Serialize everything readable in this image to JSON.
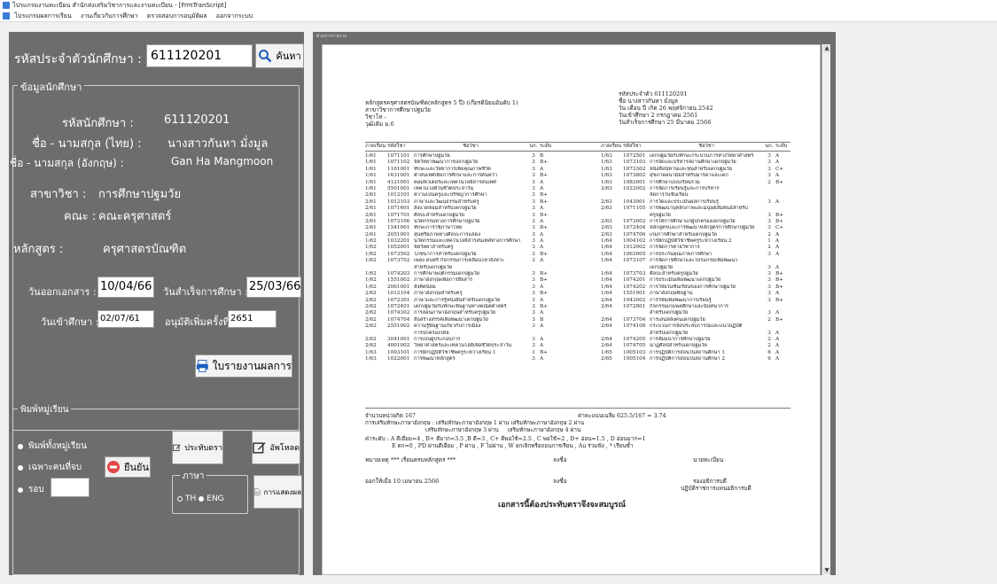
{
  "window": {
    "title": "โปรแกรมงานทะเบียน สำนักส่งเสริมวิชาการและงานทะเบียน - [FrmTranScript]"
  },
  "menu": [
    "โปรแกรมผลการเรียน",
    "งานเกี่ยวกับการศึกษา",
    "ตรวจสอบการอนุมัติผล",
    "ออกจากระบบ"
  ],
  "left": {
    "student_id_label": "รหัสประจำตัวนักศึกษา :",
    "student_id_value": "611120201",
    "search_button": "ค้นหา",
    "info_group_title": "ข้อมูลนักศึกษา",
    "sid_label": "รหัสนักศึกษา :",
    "sid_value": "611120201",
    "name_th_label": "ชื่อ - นามสกุล (ไทย) :",
    "name_th_value": "นางสาวกันหา  มั่งมูล",
    "name_en_label": "ชื่อ - นามสกุล (อังกฤษ) :",
    "name_en_value": "Gan Ha  Mangmoon",
    "major_label": "สาขาวิชา :",
    "major_value": "การศึกษาปฐมวัย",
    "faculty_label": "คณะ :",
    "faculty_value": "คณะครุศาสตร์",
    "curriculum_label": "หลักสูตร :",
    "curriculum_value": "ครุศาสตรบัณฑิต",
    "issue_label": "วันออกเอกสาร :",
    "issue_value": "10/04/66",
    "grad_label": "วันสำเร็จการศึกษา :",
    "grad_value": "25/03/66",
    "enter_label": "วันเข้าศึกษา :",
    "enter_value": "02/07/61",
    "approve_label": "อนุมัติเพิ่มครั้งที่ :",
    "approve_value": "2651",
    "report_button": "ใบรายงานผลการ",
    "print_group_title": "พิมพ์หมู่เรียน",
    "radio_all": "พิมพ์ทั้งหมู่เรียน",
    "radio_only": "เฉพาะคนที่จบ",
    "radio_round": "รอบ",
    "confirm_button": "ยืนยัน",
    "cert_button": "ประทับตรา",
    "download_button": "อัพโหลด",
    "lang_group_title": "ภาษา",
    "lang_th": "TH",
    "lang_en": "ENG",
    "result_button": "การแสดงผล"
  },
  "report_frame_title": "ตัวอย่างรายงาน",
  "report": {
    "head_left": [
      "หลักสูตรครุศาสตรบัณฑิต(หลักสูตร 5 ปี) (เกียรตินิยมอันดับ 1)",
      "สาขาวิชาการศึกษาปฐมวัย",
      "วิชาโท -",
      "วุฒิเดิม ม.6"
    ],
    "head_right": [
      "รหัสประจำตัว 611120201",
      "ชื่อ นางสาวกันหา  มั่งมูล",
      "วัน เดือน ปี เกิด 26 พฤศจิกายน 2542",
      "วันเข้าศึกษา 2 กรกฎาคม 2561",
      "วันสำเร็จการศึกษา 25 มีนาคม 2566"
    ],
    "col_headers": [
      "ภาคเรียน",
      "รหัสวิชา",
      "ชื่อวิชา",
      "นก.",
      "ระดับ"
    ],
    "left_rows": [
      [
        "1/61",
        "1071101",
        "การศึกษาปฐมวัย",
        "3",
        "B"
      ],
      [
        "1/61",
        "1071102",
        "จิตวิทยาพัฒนาการเด็กปฐมวัย",
        "3",
        "B+"
      ],
      [
        "1/61",
        "1161001",
        "ทักษะและวิทยาการเพื่อคุณภาพชีวิต",
        "3",
        "A"
      ],
      [
        "1/61",
        "1631001",
        "ศาสนเทศเพื่อการศึกษาและการค้นคว้า",
        "3",
        "B+"
      ],
      [
        "1/61",
        "4121001",
        "คอมพิวเตอร์และเทคโนโลยีสารสนเทศ",
        "3",
        "A"
      ],
      [
        "1/61",
        "5501001",
        "เทคโนโลยีในชีวิตประจำวัน",
        "3",
        "A"
      ],
      [
        "2/61",
        "1012101",
        "ความเป็นครูและปรัชญาการศึกษา",
        "3",
        "B+"
      ],
      [
        "2/61",
        "1012103",
        "ภาษาและวัฒนธรรมสำหรับครู",
        "3",
        "B+"
      ],
      [
        "2/61",
        "1071601",
        "สิ่งแวดล้อมสำหรับเด็กปฐมวัย",
        "3",
        "A"
      ],
      [
        "2/61",
        "1071701",
        "ศิลปะสำหรับเด็กปฐมวัย",
        "3",
        "B+"
      ],
      [
        "2/61",
        "1072106",
        "นวัตกรรมทางการศึกษาปฐมวัย",
        "3",
        "A"
      ],
      [
        "2/61",
        "1541001",
        "ทักษะการใช้ภาษาไทย",
        "3",
        "B+"
      ],
      [
        "2/61",
        "2051001",
        "สุนทรียภาพทางศิลปะการแสดง",
        "3",
        "A"
      ],
      [
        "1/62",
        "1032201",
        "นวัตกรรมและเทคโนโลยีสารสนเทศทางการศึกษา",
        "3",
        "A"
      ],
      [
        "1/62",
        "1052001",
        "จิตวิทยาสำหรับครู",
        "3",
        "A"
      ],
      [
        "1/62",
        "1073502",
        "โภชนาการสำหรับเด็กปฐมวัย",
        "3",
        "B+"
      ],
      [
        "1/62",
        "1073702",
        "เพลง ดนตรี กิจกรรมการเคลื่อนไหวจังหวะ",
        "3",
        "A"
      ],
      [
        "",
        "",
        "สำหรับเด็กปฐมวัย",
        "",
        ""
      ],
      [
        "1/62",
        "1074203",
        "การศึกษาพฤติกรรมเด็กปฐมวัย",
        "3",
        "B+"
      ],
      [
        "1/62",
        "1551002",
        "ภาษาอังกฤษเพื่อการสื่อสาร",
        "3",
        "B+"
      ],
      [
        "1/62",
        "2061001",
        "สังคีตนิยม",
        "3",
        "A"
      ],
      [
        "2/62",
        "1012104",
        "ภาษาอังกฤษสำหรับครู",
        "3",
        "B+"
      ],
      [
        "2/62",
        "1072301",
        "ภาษาและการรู้หนังสือสำหรับเด็กปฐมวัย",
        "3",
        "A"
      ],
      [
        "2/62",
        "1072401",
        "เด็กปฐมวัยกับทักษะพื้นฐานทางคณิตศาสตร์",
        "3",
        "B+"
      ],
      [
        "2/62",
        "1074302",
        "การสอนภาษาอังกฤษสำหรับครูปฐมวัย",
        "3",
        "A"
      ],
      [
        "2/62",
        "1074704",
        "สื่อสร้างสรรค์เพื่อพัฒนาเด็กปฐมวัย",
        "3",
        "B"
      ],
      [
        "2/62",
        "2551002",
        "ความรู้พื้นฐานเกี่ยวกับการเมือง",
        "3",
        "A"
      ],
      [
        "",
        "",
        "การปกครองไทย",
        "",
        ""
      ],
      [
        "2/62",
        "3041001",
        "การเป็นผู้ประกอบการ",
        "3",
        "A"
      ],
      [
        "2/62",
        "4001002",
        "วิทยาศาสตร์และเทคโนโลยีเพื่อชีวิตประจำวัน",
        "3",
        "A"
      ],
      [
        "1/63",
        "1003101",
        "การฝึกปฏิบัติวิชาชีพครูระหว่างเรียน 1",
        "1",
        "B+"
      ],
      [
        "1/63",
        "1022001",
        "การพัฒนาหลักสูตร",
        "3",
        "A"
      ]
    ],
    "right_rows": [
      [
        "1/63",
        "1072501",
        "เด็กปฐมวัยกับทักษะกระบวนการทางวิทยาศาสตร์",
        "3",
        "A"
      ],
      [
        "1/63",
        "1073103",
        "การจัดและบริหารสถานศึกษาเด็กปฐมวัย",
        "3",
        "A"
      ],
      [
        "1/63",
        "1073302",
        "หนังสือนิทานและหุ่นสำหรับเด็กปฐมวัย",
        "3",
        "C+"
      ],
      [
        "1/63",
        "1073802",
        "สุขภาพอนามัยสำหรับมารดาและเด็ก",
        "3",
        "A"
      ],
      [
        "1/63",
        "1083001",
        "การศึกษาแบบเรียนรวม",
        "2",
        "B+"
      ],
      [
        "2/63",
        "1022002",
        "การจัดการเรียนรู้และการบริหาร",
        "",
        ""
      ],
      [
        "",
        "",
        "จัดการในชั้นเรียน",
        "",
        ""
      ],
      [
        "2/63",
        "1043001",
        "การวัดและประเมินผลการเรียนรู้",
        "3",
        "A"
      ],
      [
        "2/63",
        "1071105",
        "การพัฒนาบุคลิกภาพและมนุษย์สัมพันธ์สำหรับ",
        "",
        ""
      ],
      [
        "",
        "",
        "ครูปฐมวัย",
        "3",
        "B+"
      ],
      [
        "2/63",
        "1072602",
        "การให้การศึกษาแก่ผู้ปกครองเด็กปฐมวัย",
        "3",
        "B+"
      ],
      [
        "2/63",
        "1072404",
        "หลักสูตรและการพัฒนาหลักสูตรการศึกษาปฐมวัย",
        "3",
        "C+"
      ],
      [
        "2/63",
        "1074706",
        "เกมการศึกษาสำหรับเด็กปฐมวัย",
        "2",
        "A"
      ],
      [
        "1/64",
        "1004102",
        "การฝึกปฏิบัติวิชาชีพครูระหว่างเรียน 2",
        "1",
        "A"
      ],
      [
        "1/64",
        "1012002",
        "การจัดการค่ายวิชาการ",
        "2",
        "A"
      ],
      [
        "1/64",
        "1063005",
        "การประกันคุณภาพการศึกษา",
        "3",
        "A"
      ],
      [
        "1/64",
        "1073107",
        "การจัดการศึกษาและโปรแกรมเพื่อพัฒนา",
        "",
        ""
      ],
      [
        "",
        "",
        "เด็กปฐมวัย",
        "3",
        "A"
      ],
      [
        "1/64",
        "1073703",
        "ศิลปะสำหรับครูปฐมวัย",
        "3",
        "B+"
      ],
      [
        "1/64",
        "1074201",
        "การประเมินเพื่อพัฒนาเด็กปฐมวัย",
        "3",
        "B+"
      ],
      [
        "1/64",
        "1074202",
        "การวิจัยในชั้นเรียนของการศึกษาปฐมวัย",
        "3",
        "B+"
      ],
      [
        "1/64",
        "1551001",
        "ภาษาอังกฤษพื้นฐาน",
        "3",
        "A"
      ],
      [
        "2/64",
        "1043002",
        "การวิจัยเพื่อพัฒนาการเรียนรู้",
        "3",
        "B+"
      ],
      [
        "2/64",
        "1072801",
        "กิจกรรมเกมพลศึกษาและนันทนาการ",
        "",
        ""
      ],
      [
        "",
        "",
        "สำหรับเด็กปฐมวัย",
        "3",
        "A"
      ],
      [
        "2/64",
        "1073704",
        "การเล่นหลังคนเด็กปฐมวัย",
        "2",
        "B+"
      ],
      [
        "2/64",
        "1074108",
        "กระบวนการจัดประสบการณ์และแนวปฏิบัติ",
        "",
        ""
      ],
      [
        "",
        "",
        "สำหรับเด็กปฐมวัย",
        "3",
        "A"
      ],
      [
        "2/64",
        "1074205",
        "การสัมมนาการศึกษาปฐมวัย",
        "2",
        "A"
      ],
      [
        "2/64",
        "1074705",
        "นาฏศิลป์สำหรับเด็กปฐมวัย",
        "2",
        "A"
      ],
      [
        "1/65",
        "1005103",
        "การปฏิบัติการสอนในสถานศึกษา 1",
        "6",
        "A"
      ],
      [
        "2/65",
        "1005104",
        "การปฏิบัติการสอนในสถานศึกษา 2",
        "6",
        "A"
      ]
    ],
    "summary_credits": "จำนวนหน่วยกิต          167",
    "summary_gpa": "ค่าคะแนนเฉลี่ย    625.5/167 = 3.74",
    "eng_line1": "การเสริมทักษะภาษาอังกฤษ : เสริมทักษะภาษาอังกฤษ 1 ผ่าน     เสริมทักษะภาษาอังกฤษ 2 ผ่าน",
    "eng_line2": "                                  เสริมทักษะภาษาอังกฤษ 3 ผ่าน     เสริมทักษะภาษาอังกฤษ 4 ผ่าน",
    "grade_line1": "ค่าระดับ : A ดีเยี่ยม=4 , B+ ดีมาก=3.5 ,B ดี=3 , C+ ดีพอใช้=2.5 , C พอใช้=2 , D+ อ่อน=1.5 , D อ่อนมาก=1",
    "grade_line2": "E ตก=0 , PD ผ่านดีเยี่ยม , P ผ่าน , F ไม่ผ่าน , W ยกเลิกหรือถอนการเรียน , Au ร่วมฟัง , * เรียนซ้ำ",
    "note": "หมายเหตุ  *** เรียนครบหลักสูตร ***",
    "sign1": "ลงชื่อ",
    "registrar": "นายทะเบียน",
    "issued": "ออกให้เมื่อ 10 เมษายน 2566",
    "sign2": "ลงชื่อ",
    "vp1": "รองอธิการบดี",
    "vp2": "ปฏิบัติราชการแทนอธิการบดี",
    "footer": "เอกสารนี้ต้องประทับตราจึงจะสมบูรณ์"
  }
}
